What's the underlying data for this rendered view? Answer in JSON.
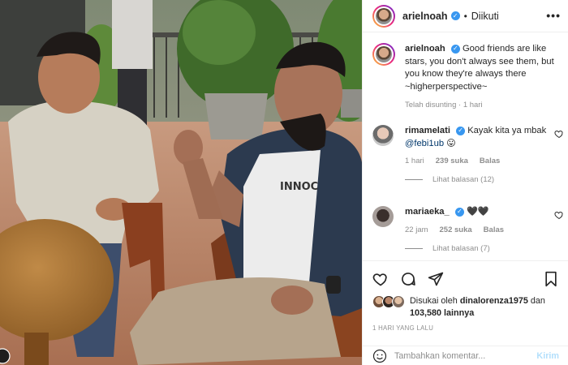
{
  "header": {
    "username": "arielnoah",
    "separator": "•",
    "follow_status": "Diikuti",
    "more_icon": "more-horizontal-icon"
  },
  "caption": {
    "username": "arielnoah",
    "text": "Good friends are like stars, you don't always see them, but you know they're always there ~higherperspective~",
    "meta": "Telah disunting · 1 hari"
  },
  "comments": [
    {
      "username": "rimamelati",
      "text": "Kayak kita ya mbak",
      "mention": "@febi1ub",
      "emoji": "😛",
      "time": "1 hari",
      "likes": "239 suka",
      "reply": "Balas",
      "view_replies": "Lihat balasan (12)"
    },
    {
      "username": "mariaeka_",
      "text": "🖤🖤",
      "time": "22 jam",
      "likes": "252 suka",
      "reply": "Balas",
      "view_replies": "Lihat balasan (7)"
    }
  ],
  "likes": {
    "prefix": "Disukai oleh",
    "user": "dinalorenza1975",
    "connector": "dan",
    "others": "103,580 lainnya"
  },
  "timestamp": "1 HARI YANG LALU",
  "add_comment": {
    "placeholder": "Tambahkan komentar...",
    "post_label": "Kirim"
  },
  "colors": {
    "verified": "#3897f0",
    "link": "#00376b",
    "muted": "#8e8e8e",
    "post_disabled": "#b2dffc"
  }
}
